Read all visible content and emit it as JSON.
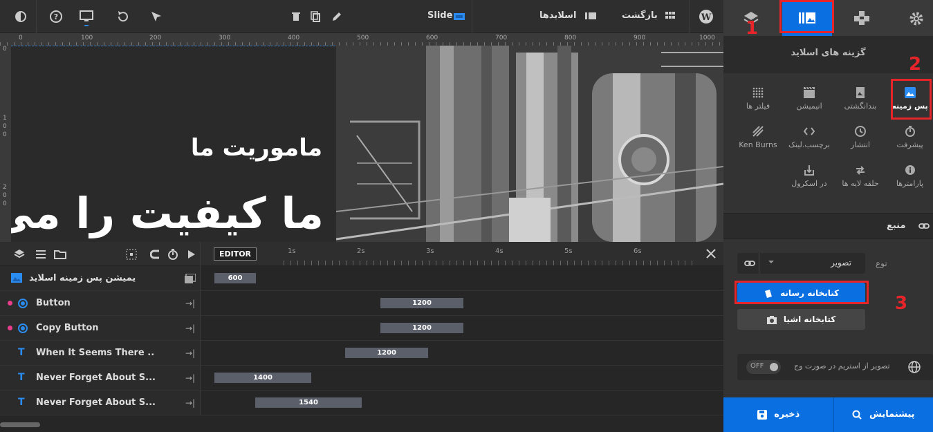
{
  "topbar": {
    "slide_label": "Slide",
    "back_label": "بازگشت",
    "slides_label": "اسلایدها"
  },
  "ruler": {
    "marks": [
      "0",
      "100",
      "200",
      "300",
      "400",
      "500",
      "600",
      "700",
      "800",
      "900",
      "1000"
    ],
    "left_marks": [
      "0",
      "1",
      "0",
      "0",
      "2",
      "0",
      "0"
    ]
  },
  "canvas": {
    "subtitle": "ماموریت ما",
    "headline": "ما کیفیت را می"
  },
  "timeline": {
    "editor_label": "EDITOR",
    "time_marks": [
      "1s",
      "2s",
      "3s",
      "4s",
      "5s",
      "6s"
    ],
    "rows": [
      {
        "label": "یمیشن پس زمینه اسلاید",
        "bar": "600",
        "type": "bg"
      },
      {
        "label": "Button",
        "bar": "1200",
        "type": "button"
      },
      {
        "label": "Copy Button",
        "bar": "1200",
        "type": "button"
      },
      {
        "label": "When It Seems There ..",
        "bar": "1200",
        "type": "text"
      },
      {
        "label": "Never Forget About S...",
        "bar": "1400",
        "type": "text"
      },
      {
        "label": "Never Forget About S...",
        "bar": "1540",
        "type": "text"
      }
    ]
  },
  "panel": {
    "title": "گزینه های اسلاید",
    "options": [
      {
        "label": "پس زمینه",
        "icon": "image-icon",
        "active": true
      },
      {
        "label": "بندانگشتی",
        "icon": "thumbnail-icon"
      },
      {
        "label": "انیمیشن",
        "icon": "film-icon"
      },
      {
        "label": "فیلتر ها",
        "icon": "filter-icon"
      },
      {
        "label": "پیشرفت",
        "icon": "stopwatch-icon"
      },
      {
        "label": "انتشار",
        "icon": "clock-icon"
      },
      {
        "label": "برچسب.لینک",
        "icon": "code-icon"
      },
      {
        "label": "Ken Burns",
        "icon": "kenburns-icon"
      },
      {
        "label": "پارامترها",
        "icon": "info-icon"
      },
      {
        "label": "حلقه لایه ها",
        "icon": "loop-icon"
      },
      {
        "label": "در اسکرول",
        "icon": "scroll-icon"
      }
    ],
    "source_label": "منبع",
    "type_label": "نوع",
    "type_value": "تصویر",
    "media_library": "کتابخانه رسانه",
    "object_library": "کتابخانه اشیا",
    "stream_label": "تصویر از استریم در صورت وج",
    "toggle": "OFF",
    "save": "ذخیره",
    "preview": "پیشنمایش"
  },
  "annotations": [
    "1",
    "2",
    "3"
  ],
  "colors": {
    "accent": "#0a6fe0",
    "annotation": "#e8242b"
  }
}
